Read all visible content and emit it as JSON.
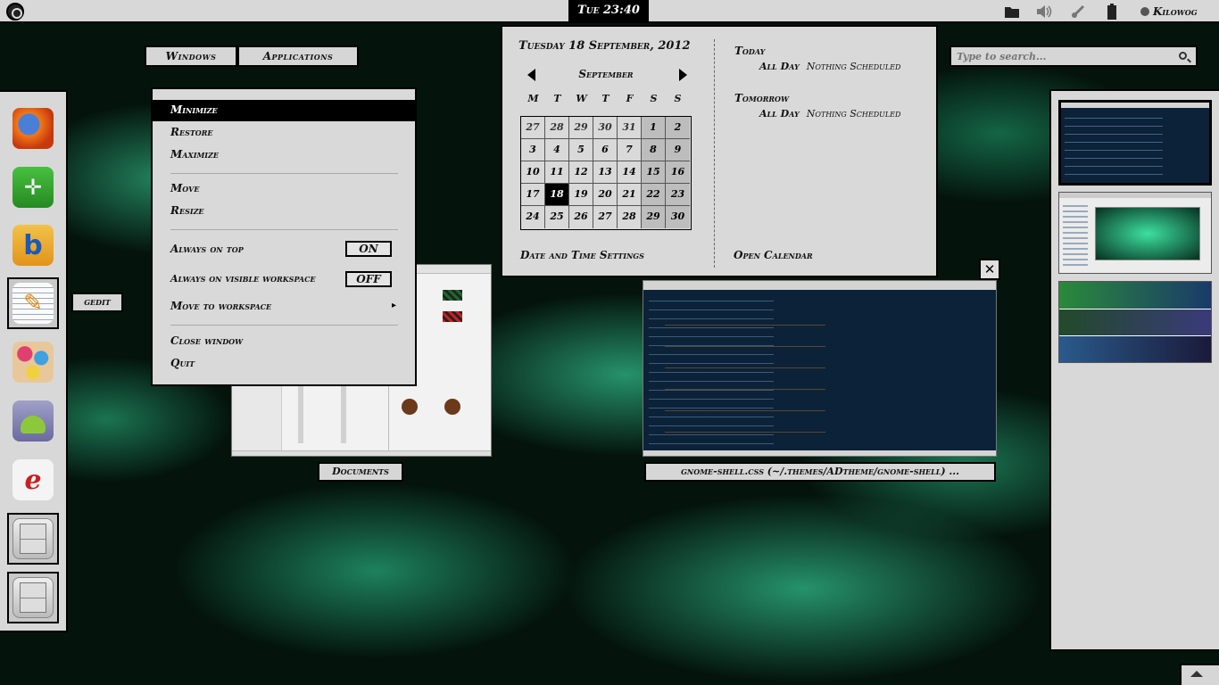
{
  "topbar": {
    "clock": "Tue 23:40",
    "user": "Kilowog",
    "icons": [
      "folder-icon",
      "volume-icon",
      "network-icon",
      "battery-icon",
      "user-status-icon"
    ]
  },
  "overview": {
    "windows_tab": "Windows",
    "applications_tab": "Applications"
  },
  "dash": {
    "items": [
      "firefox-icon",
      "compass-icon",
      "bluefish-icon",
      "gedit-icon",
      "paint-icon",
      "android-icon",
      "emacs-icon",
      "file-cabinet-icon",
      "file-cabinet-icon"
    ],
    "tooltip": "gedit"
  },
  "context_menu": {
    "minimize": "Minimize",
    "restore": "Restore",
    "maximize": "Maximize",
    "move": "Move",
    "resize": "Resize",
    "always_on_top": "Always on top",
    "always_on_top_state": "ON",
    "always_on_visible_workspace": "Always on visible workspace",
    "always_on_visible_workspace_state": "OFF",
    "move_to_workspace": "Move to workspace",
    "move_to_workspace_arrow": "▸",
    "close_window": "Close window",
    "quit": "Quit"
  },
  "windows": {
    "documents_label": "Documents",
    "gedit_label": "gnome-shell.css (~/.themes/ADtheme/gnome-shell) ...",
    "close_glyph": "✕"
  },
  "calendar": {
    "date_heading": "Tuesday 18 September, 2012",
    "month": "September",
    "weekdays": [
      "M",
      "T",
      "W",
      "T",
      "F",
      "S",
      "S"
    ],
    "weeks": [
      [
        "27",
        "28",
        "29",
        "30",
        "31",
        "1",
        "2"
      ],
      [
        "3",
        "4",
        "5",
        "6",
        "7",
        "8",
        "9"
      ],
      [
        "10",
        "11",
        "12",
        "13",
        "14",
        "15",
        "16"
      ],
      [
        "17",
        "18",
        "19",
        "20",
        "21",
        "22",
        "23"
      ],
      [
        "24",
        "25",
        "26",
        "27",
        "28",
        "29",
        "30"
      ]
    ],
    "today": "18",
    "events": {
      "today_heading": "Today",
      "today_when": "All Day",
      "today_what": "Nothing Scheduled",
      "tomorrow_heading": "Tomorrow",
      "tomorrow_when": "All Day",
      "tomorrow_what": "Nothing Scheduled"
    },
    "settings_link": "Date and Time Settings",
    "open_calendar_link": "Open Calendar"
  },
  "search": {
    "placeholder": "Type to search..."
  },
  "colors": {
    "panel_bg": "#d8d8d8",
    "border": "#000000",
    "wallpaper_green": "#3de0a0"
  }
}
